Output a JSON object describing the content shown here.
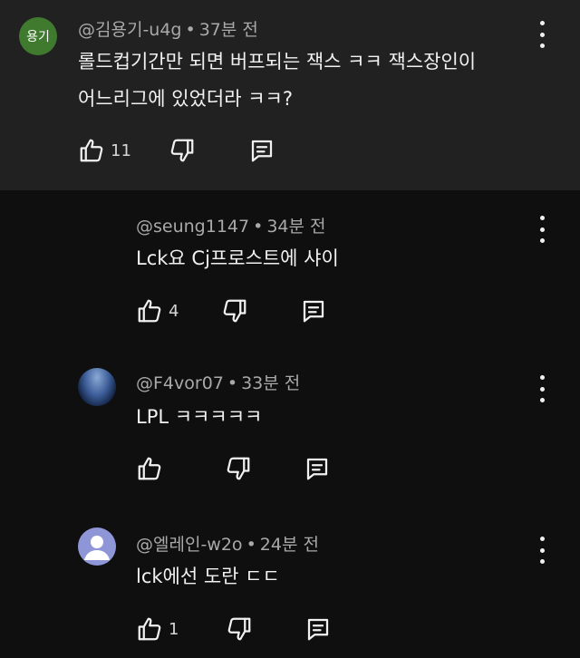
{
  "comments": [
    {
      "avatar_text": "용기",
      "author": "@김용기-u4g",
      "time": "37분 전",
      "lines": [
        "롤드컵기간만 되면 버프되는 잭스 ㅋㅋ 잭스장인이",
        "어느리그에 있었더라 ㅋㅋ?"
      ],
      "likes": "11"
    },
    {
      "author": "@seung1147",
      "time": "34분 전",
      "lines": [
        "Lck요 Cj프로스트에 샤이"
      ],
      "likes": "4"
    },
    {
      "author": "@F4vor07",
      "time": "33분 전",
      "lines": [
        "LPL ㅋㅋㅋㅋㅋ"
      ],
      "likes": ""
    },
    {
      "author": "@엘레인-w2o",
      "time": "24분 전",
      "lines": [
        "lck에선 도란 ㄷㄷ"
      ],
      "likes": "1"
    }
  ],
  "separator": "•",
  "icons": {
    "like": "thumbs-up-icon",
    "dislike": "thumbs-down-icon",
    "reply": "reply-icon",
    "more": "more-vertical-icon"
  },
  "colors": {
    "top_background": "#212121",
    "background": "#0f0f0f",
    "avatar_green": "#3f7a2f",
    "avatar_default": "#8f96d8"
  }
}
